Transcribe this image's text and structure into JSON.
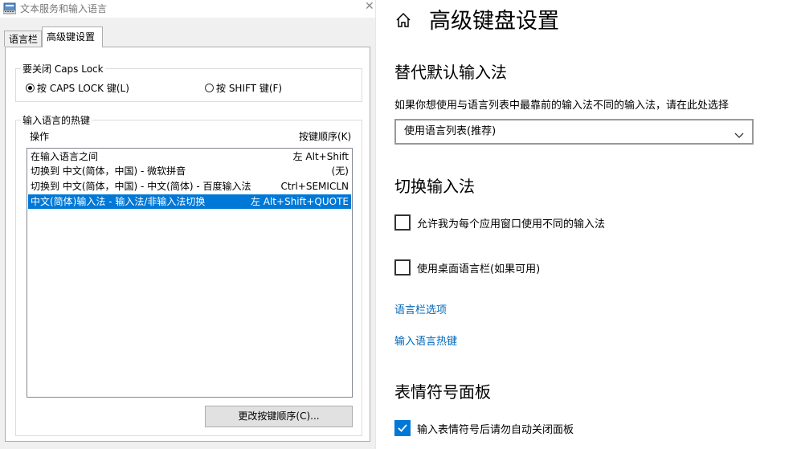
{
  "dialog": {
    "title": "文本服务和输入语言",
    "tabs": [
      {
        "label": "语言栏",
        "active": false
      },
      {
        "label": "高级键设置",
        "active": true
      }
    ],
    "caps_group": {
      "legend": "要关闭 Caps Lock",
      "options": [
        {
          "label": "按 CAPS LOCK 键(L)",
          "selected": true
        },
        {
          "label": "按 SHIFT 键(F)",
          "selected": false
        }
      ]
    },
    "hotkey_group": {
      "legend": "输入语言的热键",
      "col_action": "操作",
      "col_keys": "按键顺序(K)",
      "rows": [
        {
          "action": "在输入语言之间",
          "keys": "左 Alt+Shift",
          "selected": false
        },
        {
          "action": "切换到 中文(简体，中国) - 微软拼音",
          "keys": "(无)",
          "selected": false
        },
        {
          "action": "切换到 中文(简体，中国) - 中文(简体) - 百度输入法",
          "keys": "Ctrl+SEMICLN",
          "selected": false
        },
        {
          "action": "中文(简体)输入法 - 输入法/非输入法切换",
          "keys": "左 Alt+Shift+QUOTE",
          "selected": true
        }
      ]
    },
    "change_button": "更改按键顺序(C)...",
    "selection_color": "#0078d7"
  },
  "settings": {
    "title": "高级键盘设置",
    "override": {
      "heading": "替代默认输入法",
      "description": "如果你想使用与语言列表中最靠前的输入法不同的输入法，请在此处选择",
      "selected": "使用语言列表(推荐)"
    },
    "switching": {
      "heading": "切换输入法",
      "checkboxes": [
        {
          "label": "允许我为每个应用窗口使用不同的输入法",
          "checked": false
        },
        {
          "label": "使用桌面语言栏(如果可用)",
          "checked": false
        }
      ],
      "links": [
        "语言栏选项",
        "输入语言热键"
      ]
    },
    "emoji": {
      "heading": "表情符号面板",
      "checkbox": {
        "label": "输入表情符号后请勿自动关闭面板",
        "checked": true
      }
    },
    "accent_color": "#0078d7",
    "link_color": "#0067b8"
  }
}
